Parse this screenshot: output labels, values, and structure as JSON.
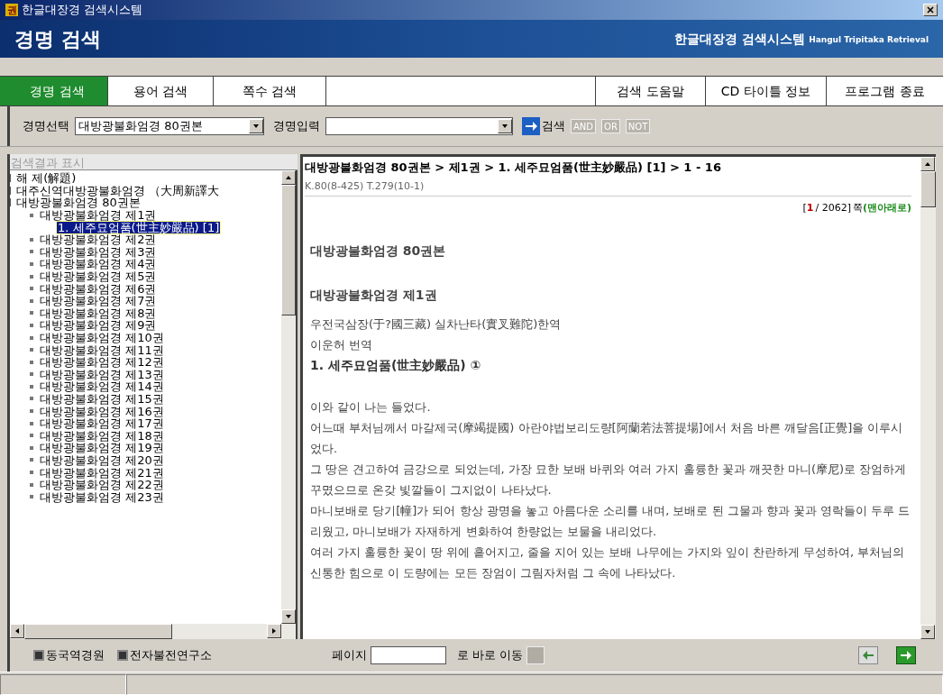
{
  "window": {
    "title": "한글대장경 검색시스템",
    "app_icon": "권"
  },
  "banner": {
    "title": "경명 검색",
    "brand": "한글대장경 검색시스템",
    "brand_en": "Hangul Tripitaka Retrieval"
  },
  "nav_left": [
    {
      "label": "경명 검색",
      "selected": true
    },
    {
      "label": "용어 검색",
      "selected": false
    },
    {
      "label": "쪽수 검색",
      "selected": false
    }
  ],
  "nav_right": [
    "검색 도움말",
    "CD 타이틀 정보",
    "프로그램 종료"
  ],
  "toolbar": {
    "select_label": "경명선택",
    "select_value": "대방광불화엄경 80권본",
    "input_label": "경명입력",
    "search_label": "검색",
    "operators": [
      "AND",
      "OR",
      "NOT"
    ]
  },
  "results_header": "검색결과 표시",
  "tree": [
    {
      "label": "해 제(解題)",
      "selected": false
    },
    {
      "label": "대주신역대방광불화엄경 （大周新譯大",
      "selected": false
    },
    {
      "label": "대방광불화엄경 80권본",
      "selected": false,
      "children": [
        {
          "label": "대방광불화엄경 제1권",
          "selected": false,
          "children": [
            {
              "label": "1. 세주묘엄품(世主妙嚴品) [1]",
              "selected": true
            }
          ]
        },
        {
          "label": "대방광불화엄경 제2권",
          "selected": false
        },
        {
          "label": "대방광불화엄경 제3권",
          "selected": false
        },
        {
          "label": "대방광불화엄경 제4권",
          "selected": false
        },
        {
          "label": "대방광불화엄경 제5권",
          "selected": false
        },
        {
          "label": "대방광불화엄경 제6권",
          "selected": false
        },
        {
          "label": "대방광불화엄경 제7권",
          "selected": false
        },
        {
          "label": "대방광불화엄경 제8권",
          "selected": false
        },
        {
          "label": "대방광불화엄경 제9권",
          "selected": false
        },
        {
          "label": "대방광불화엄경 제10권",
          "selected": false
        },
        {
          "label": "대방광불화엄경 제11권",
          "selected": false
        },
        {
          "label": "대방광불화엄경 제12권",
          "selected": false
        },
        {
          "label": "대방광불화엄경 제13권",
          "selected": false
        },
        {
          "label": "대방광불화엄경 제14권",
          "selected": false
        },
        {
          "label": "대방광불화엄경 제15권",
          "selected": false
        },
        {
          "label": "대방광불화엄경 제16권",
          "selected": false
        },
        {
          "label": "대방광불화엄경 제17권",
          "selected": false
        },
        {
          "label": "대방광불화엄경 제18권",
          "selected": false
        },
        {
          "label": "대방광불화엄경 제19권",
          "selected": false
        },
        {
          "label": "대방광불화엄경 제20권",
          "selected": false
        },
        {
          "label": "대방광불화엄경 제21권",
          "selected": false
        },
        {
          "label": "대방광불화엄경 제22권",
          "selected": false
        },
        {
          "label": "대방광불화엄경 제23권",
          "selected": false
        }
      ]
    }
  ],
  "document": {
    "breadcrumb": "대방광불화엄경 80권본 > 제1권 > 1. 세주묘엄품(世主妙嚴品) [1] > 1 - 16",
    "reference": "K.80(8-425) T.279(10-1)",
    "page": {
      "open": "[",
      "current": "1",
      "total": "/ 2062]",
      "unit": "쪽",
      "link": "(맨아래로)"
    },
    "blocks": [
      {
        "kind": "heading",
        "text": "대방광불화엄경 80권본"
      },
      {
        "kind": "heading",
        "text": "대방광불화엄경 제1권"
      },
      {
        "kind": "line",
        "text": "우전국삼장(于?國三藏) 실차난타(實叉難陀)한역"
      },
      {
        "kind": "line",
        "text": "이운허 번역"
      },
      {
        "kind": "title",
        "text": "1. 세주묘엄품(世主妙嚴品) ①"
      },
      {
        "kind": "gap"
      },
      {
        "kind": "line",
        "text": "이와 같이 나는 들었다."
      },
      {
        "kind": "line",
        "text": "어느때 부처님께서 마갈제국(摩竭提國) 아란야법보리도량[阿蘭若法菩提場]에서 처음 바른 깨달음[正覺]을 이루시었다."
      },
      {
        "kind": "line",
        "text": "그 땅은 견고하여 금강으로 되었는데, 가장 묘한 보배 바퀴와 여러 가지 훌륭한 꽃과 깨끗한 마니(摩尼)로 장엄하게 꾸몄으므로 온갖 빛깔들이 그지없이 나타났다."
      },
      {
        "kind": "line",
        "text": "마니보배로 당기[幢]가 되어 항상 광명을 놓고 아름다운 소리를 내며, 보배로 된 그물과 향과 꽃과 영락들이 두루 드리웠고, 마니보배가 자재하게 변화하여 한량없는 보물을 내리었다."
      },
      {
        "kind": "line",
        "text": "여러 가지 훌륭한 꽃이 땅 위에 흩어지고, 줄을 지어 있는 보배 나무에는 가지와 잎이 찬란하게 무성하여, 부처님의 신통한 힘으로 이 도량에는 모든 장엄이 그림자처럼 그 속에 나타났다."
      }
    ]
  },
  "footer": {
    "links": [
      "동국역경원",
      "전자불전연구소"
    ],
    "page_label": "페이지",
    "goto_label": "로 바로 이동"
  }
}
